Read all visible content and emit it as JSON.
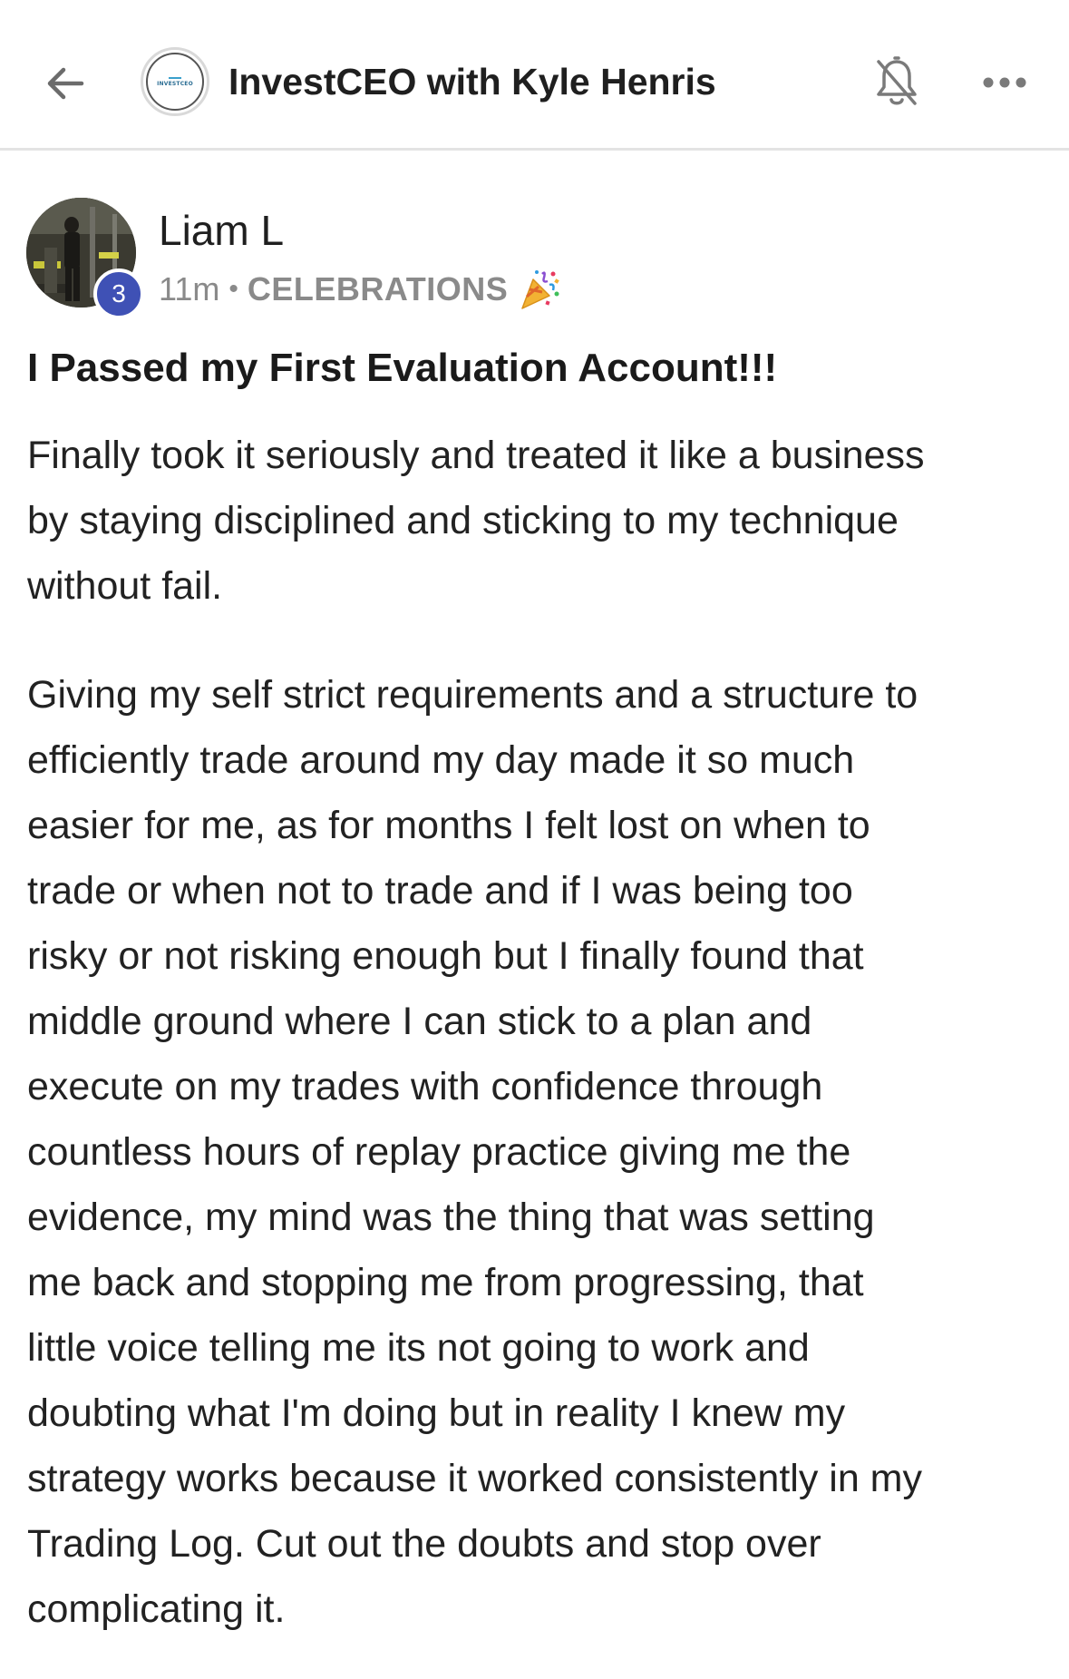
{
  "header": {
    "group_name": "InvestCEO with Kyle Henris",
    "logo_text": "INVESTCEO"
  },
  "post": {
    "author": "Liam L",
    "level": "3",
    "time": "11m",
    "separator": "•",
    "category": "CELEBRATIONS",
    "title": "I Passed my First Evaluation Account!!!",
    "paragraph1": [
      "Finally took it seriously and treated it like a business",
      "by staying disciplined and sticking to my technique",
      "without fail."
    ],
    "paragraph2": [
      "Giving my self strict requirements and a structure to",
      "efficiently trade around my day made it so much",
      "easier for me, as for months I felt lost on when to",
      "trade or when not to trade and if I was being too",
      "risky or not risking enough but I finally found that",
      "middle ground where I can stick to a plan and",
      "execute on my trades with confidence through",
      "countless hours of replay practice giving me the",
      "evidence, my mind was the thing that was setting",
      "me back and stopping me from progressing, that",
      "little voice telling me its not going to work and",
      "doubting what I'm doing but in reality I knew my",
      "strategy works because it worked consistently in my",
      "Trading Log. Cut out the doubts and stop over",
      "complicating it."
    ]
  },
  "icons": {
    "back": "arrow-left-icon",
    "notifications": "bell-off-icon",
    "more": "more-horizontal-icon",
    "category_emoji": "party-popper-icon"
  },
  "colors": {
    "level_badge": "#3f51b5",
    "meta_text": "#8a8a8a",
    "body_text": "#222222"
  }
}
